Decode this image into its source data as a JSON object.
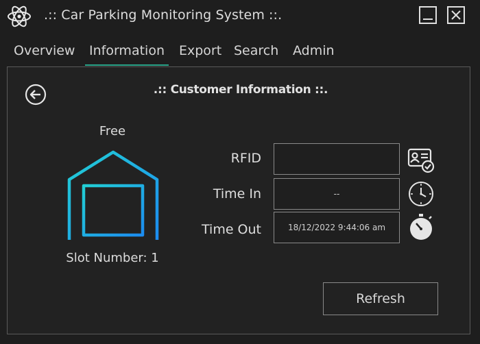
{
  "window": {
    "title": ".:: Car Parking Monitoring System ::."
  },
  "tabs": [
    {
      "label": "Overview"
    },
    {
      "label": "Information",
      "active": true
    },
    {
      "label": "Export"
    },
    {
      "label": "Search"
    },
    {
      "label": "Admin"
    }
  ],
  "panel": {
    "heading": ".:: Customer Information ::.",
    "status": "Free",
    "slot_label": "Slot Number: 1",
    "fields": [
      {
        "label": "RFID",
        "value": "",
        "icon": "id-card-check-icon"
      },
      {
        "label": "Time In",
        "value": "--",
        "icon": "clock-icon"
      },
      {
        "label": "Time Out",
        "value": "18/12/2022 9:44:06 am",
        "icon": "stopwatch-icon"
      }
    ],
    "refresh_label": "Refresh"
  },
  "colors": {
    "background": "#1e1e1e",
    "accent_teal": "#2aa58a",
    "garage_cyan": "#22cfd4",
    "garage_blue": "#1c8cf0"
  }
}
